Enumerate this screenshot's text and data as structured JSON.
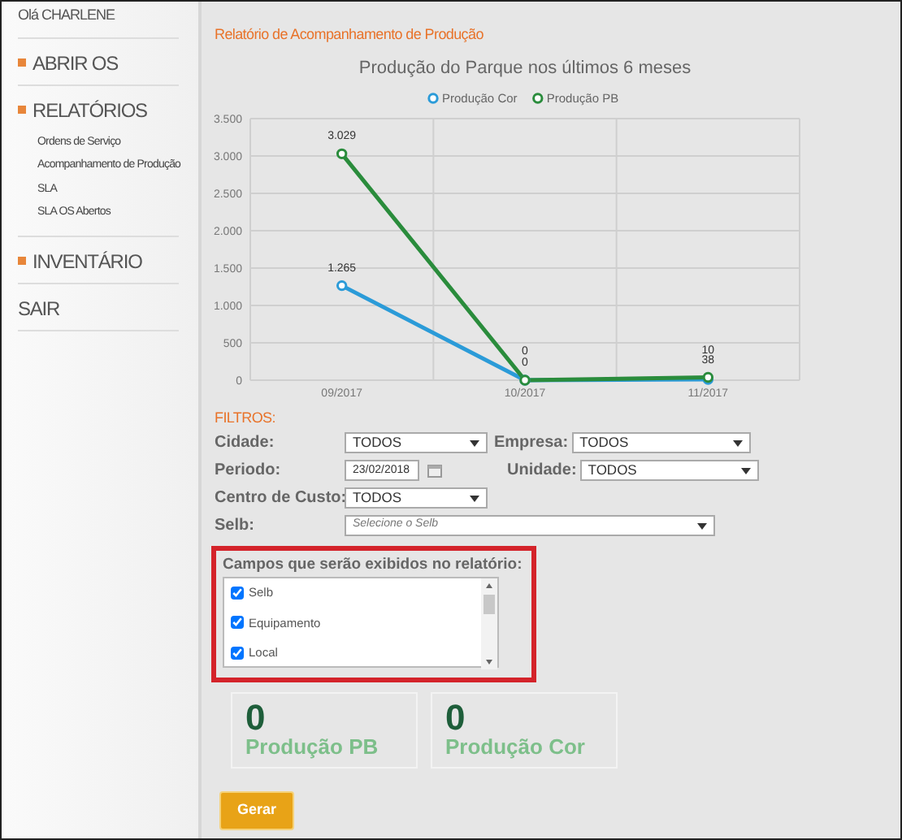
{
  "sidebar": {
    "greeting": "Olá CHARLENE",
    "menu": [
      {
        "label": "ABRIR OS",
        "kind": "section"
      },
      {
        "label": "RELATÓRIOS",
        "kind": "section",
        "children": [
          {
            "label": "Ordens de Serviço"
          },
          {
            "label": "Acompanhamento de Produção"
          },
          {
            "label": "SLA"
          },
          {
            "label": "SLA OS Abertos"
          }
        ]
      },
      {
        "label": "INVENTÁRIO",
        "kind": "section"
      },
      {
        "label": "SAIR",
        "kind": "plain"
      }
    ]
  },
  "report_title": "Relatório de Acompanhamento de Produção",
  "chart": {
    "chart_data": {
      "type": "line",
      "title": "Produção do Parque nos últimos 6 meses",
      "categories": [
        "09/2017",
        "10/2017",
        "11/2017"
      ],
      "series": [
        {
          "name": "Produção Cor",
          "color": "#2b9bd8",
          "values": [
            1265,
            0,
            10
          ],
          "marker": "circle",
          "value_labels": [
            "1.265",
            "0",
            "10"
          ]
        },
        {
          "name": "Produção PB",
          "color": "#2a8c3c",
          "values": [
            3029,
            0,
            38
          ],
          "marker": "circle",
          "value_labels": [
            "3.029",
            "0",
            "38"
          ]
        }
      ],
      "ylim": [
        0,
        3500
      ],
      "yticks": [
        {
          "value": 0,
          "label": "0"
        },
        {
          "value": 500,
          "label": "500"
        },
        {
          "value": 1000,
          "label": "1.000"
        },
        {
          "value": 1500,
          "label": "1.500"
        },
        {
          "value": 2000,
          "label": "2.000"
        },
        {
          "value": 2500,
          "label": "2.500"
        },
        {
          "value": 3000,
          "label": "3.000"
        },
        {
          "value": 3500,
          "label": "3.500"
        }
      ],
      "data_labels": true,
      "grid": true,
      "legend": true
    }
  },
  "filters": {
    "title": "FILTROS:",
    "rows": [
      [
        {
          "label": "Cidade:",
          "kind": "select",
          "value": "TODOS"
        },
        {
          "label": "Empresa:",
          "kind": "select",
          "value": "TODOS"
        }
      ],
      [
        {
          "label": "Periodo:",
          "kind": "date",
          "value": "23/02/2018"
        },
        {
          "label": "Unidade:",
          "kind": "select",
          "value": "TODOS"
        }
      ],
      [
        {
          "label": "Centro de Custo:",
          "kind": "select",
          "value": "TODOS"
        }
      ],
      [
        {
          "label": "Selb:",
          "kind": "wide-select",
          "placeholder": "Selecione o Selb"
        }
      ]
    ]
  },
  "fields": {
    "title": "Campos que serão exibidos no relatório:",
    "items": [
      {
        "label": "Selb",
        "checked": true
      },
      {
        "label": "Equipamento",
        "checked": true
      },
      {
        "label": "Local",
        "checked": true
      }
    ]
  },
  "counters": [
    {
      "value": "0",
      "label": "Produção PB"
    },
    {
      "value": "0",
      "label": "Produção Cor"
    }
  ],
  "button": "Gerar"
}
